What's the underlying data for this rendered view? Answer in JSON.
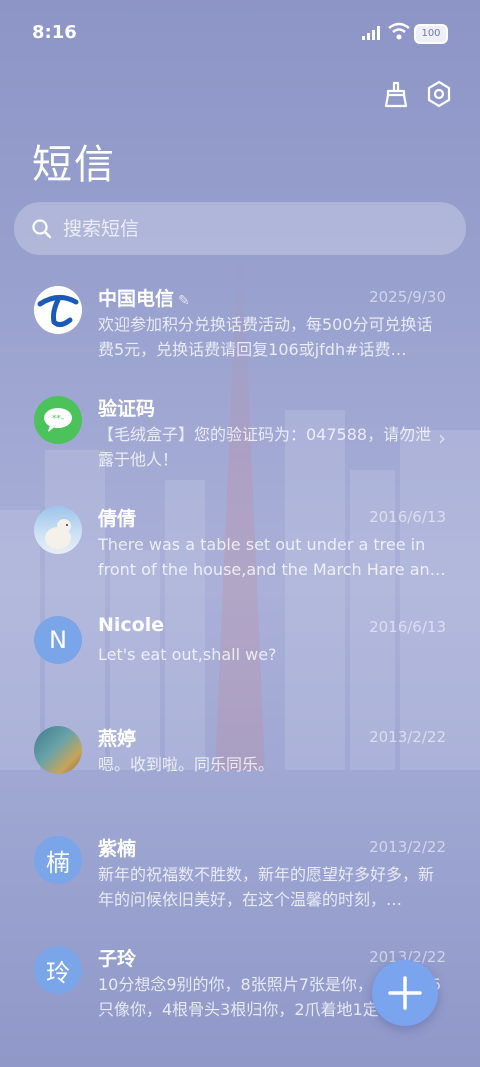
{
  "status_bar": {
    "time": "8:16",
    "battery": "100"
  },
  "header": {
    "title": "短信"
  },
  "search": {
    "placeholder": "搜索短信"
  },
  "messages": [
    {
      "name": "中国电信",
      "date": "2025/9/30",
      "preview": "欢迎参加积分兑换话费活动，每500分可兑换话费5元，兑换话费请回复106或jfdh#话费…",
      "avatar": "china-telecom-logo"
    },
    {
      "name": "验证码",
      "date": "",
      "preview": "【毛绒盒子】您的验证码为：047588，请勿泄露于他人！",
      "avatar": "message-bubble-icon"
    },
    {
      "name": "倩倩",
      "date": "2016/6/13",
      "preview": "There was a table set out under a tree in front of the house,and the March Hare an…",
      "avatar": "polar-bear-photo"
    },
    {
      "name": "Nicole",
      "date": "2016/6/13",
      "preview": "Let's eat out,shall we?",
      "avatar_letter": "N"
    },
    {
      "name": "燕婷",
      "date": "2013/2/22",
      "preview": "嗯。收到啦。同乐同乐。",
      "avatar": "landscape-photo"
    },
    {
      "name": "紫楠",
      "date": "2013/2/22",
      "preview": "新年的祝福数不胜数，新年的愿望好多好多，新年的问候依旧美好，在这个温馨的时刻，…",
      "avatar_letter": "楠"
    },
    {
      "name": "子玲",
      "date": "2013/2/22",
      "preview": "10分想念9别的你，8张照片7张是你，6只小狗5只像你，4根骨头3根归你，2爪着地1定…",
      "avatar_letter": "玲"
    }
  ],
  "colors": {
    "accent": "#7aa5ee",
    "telecom_blue": "#1a5bb8",
    "green_bubble": "#4cc25a"
  }
}
